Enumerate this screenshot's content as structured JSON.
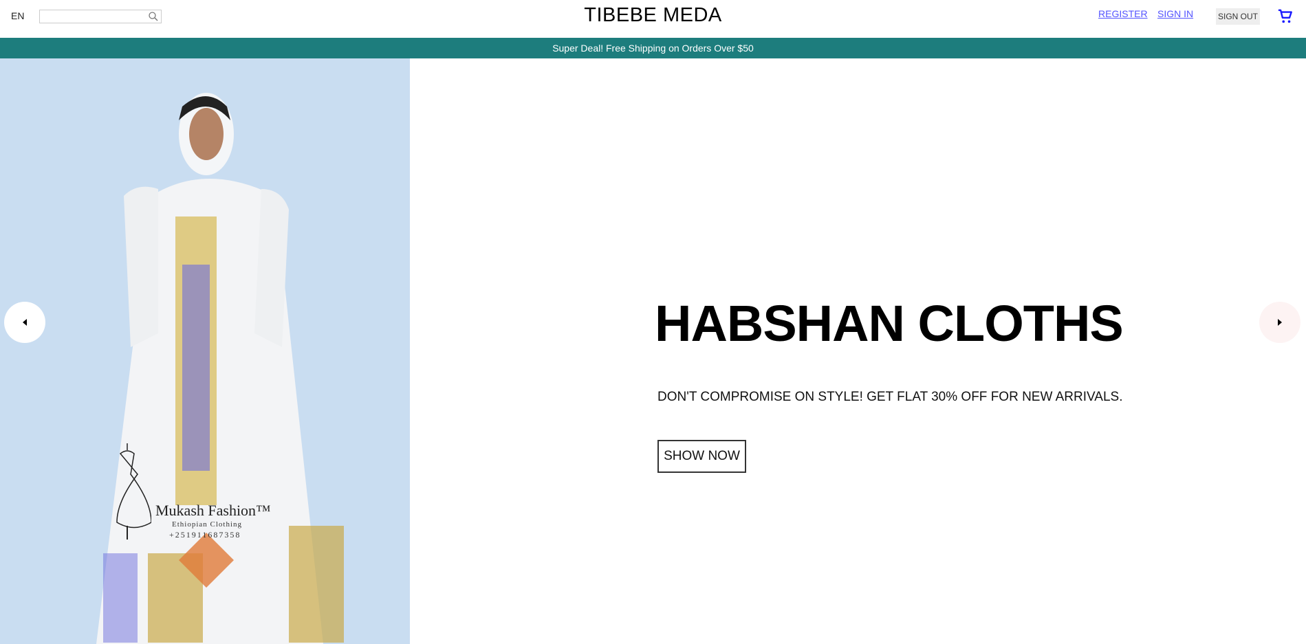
{
  "header": {
    "language": "EN",
    "search": {
      "value": "",
      "placeholder": ""
    },
    "brand": "TIBEBE MEDA",
    "register": "REGISTER",
    "sign_in": "SIGN IN",
    "sign_out": "SIGN OUT",
    "cart_icon": "shopping-cart-icon",
    "link_color": "#5555ff"
  },
  "promo": {
    "text": "Super Deal! Free Shipping on Orders Over $50",
    "color": "#1d7d7d"
  },
  "hero": {
    "image_logo": {
      "name": "Mukash Fashion™",
      "tagline": "Ethiopian Clothing",
      "phone": "+251911687358"
    },
    "title": "HABSHAN CLOTHS",
    "subtitle": "DON'T COMPROMISE ON STYLE! GET FLAT 30% OFF FOR NEW ARRIVALS.",
    "button": "SHOW NOW",
    "prev_icon": "caret-left-icon",
    "next_icon": "caret-right-icon"
  }
}
